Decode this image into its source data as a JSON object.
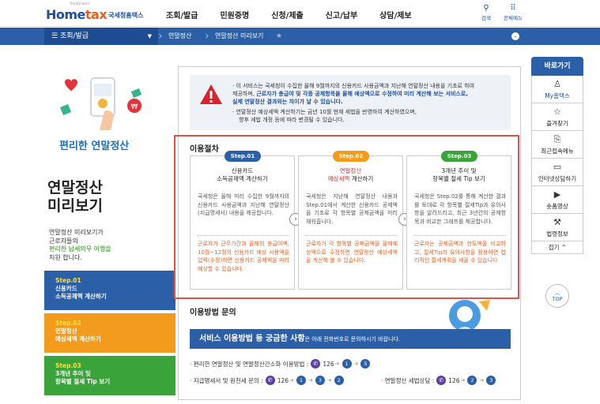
{
  "header": {
    "logo_small": "전자세무서비스",
    "logo_brand_a": "Home",
    "logo_brand_b": "tax",
    "logo_org": "국세청홈택스",
    "gnb": [
      "조회/발급",
      "민원증명",
      "신청/제출",
      "신고/납부",
      "상담/제보"
    ],
    "search_label": "검색",
    "allmenu_label": "전체메뉴"
  },
  "navbar": {
    "menu_label": "조회/발급",
    "crumb1": "연말정산",
    "crumb2": "연말정산 미리보기"
  },
  "left": {
    "illus_title": "편리한 연말정산",
    "title_line1": "연말정산",
    "title_line2": "미리보기",
    "desc1": "연말정산 미리보기가",
    "desc2": "근로자들의",
    "desc3": "편리한 납세의무 이행을",
    "desc4": "지원 합니다.",
    "steps": [
      {
        "num": "Step.01",
        "l1": "신용카드",
        "l2": "소득공제액 계산하기",
        "color": "#2b5fa8"
      },
      {
        "num": "Step.02",
        "l1": "연말정산",
        "l2": "예상세액 계산하기",
        "color": "#f29b1d"
      },
      {
        "num": "Step.03",
        "l1": "3개년 추이 및",
        "l2": "항목별 절세 Tip 보기",
        "color": "#3aa33a"
      }
    ]
  },
  "notice": {
    "l1": "· 이 서비스는 국세청이 수집한 올해 9월까지의 신용카드 사용금액과 지난해 연말정산 내용을 기초로 하여",
    "l2a": "제공하며, ",
    "l2b": "근로자가 총급여 및 각종 공제항목을 올해 예상액으로 수정하여 미리 계산해 보는 서비스로,",
    "l3": "실제 연말정산 결과와는 차이가 날 수 있습니다.",
    "l4": "· 연말정산 예상세액 계산하기는 금년 10월 현재 세법을 반영하여 계산하였으며,",
    "l5": "향후 세법 개정 등에 따라 변경될 수 있습니다."
  },
  "procedure": {
    "title": "이용절차",
    "cards": [
      {
        "badge": "Step.01",
        "badge_color": "#2b5fa8",
        "t1": "신용카드",
        "t2": "소득공제액 계산하기",
        "body": "국세청은 올해 미리 수집한 9월까지의 신용카드 사용금액과 지난해 연말정산(지급명세서) 내용을 제공합니다.",
        "foot": "근로자가 근무기간과 올해의 총급여액, 10월~12월의 신용카드 예상 사용액을 입력(수정)하면 신용카드 공제액을 미리 예상할 수 있습니다."
      },
      {
        "badge": "Step.02",
        "badge_color": "#f29b1d",
        "t1": "연말정산",
        "t2": "예상세액",
        "t2b": " 계산하기",
        "body": "국세청은 지난해 연말정산 내용과 Step.01에서 계산한 신용카드 공제액을 기초로 각 항목별 공제금액을 미리 채워줍니다.",
        "foot": "근로자가 각 항목별 공제금액을 올해예상액으로 수정하면 연말정산 예상세액을 계산해 볼 수 있습니다."
      },
      {
        "badge": "Step.03",
        "badge_color": "#3aa33a",
        "t1": "3개년 추이 및",
        "t2": "항목별 절세 Tip 보기",
        "body": "국세청은 Step.02를 통해 계산한 결과를 토대로 각 항목별 절세Tip과 유의사항을 알려드리고, 최근 3년간의 공제항목과 비교한 그래프를 제공합니다.",
        "foot": "근로자는 공제금액과 한도액을 비교하고, 절세Tip과 유의사항을 활용하면 합리적인 절세계획을 세울 수 있습니다"
      }
    ]
  },
  "inquiry": {
    "title": "이용방법 문의",
    "bar_bold": "서비스 이용방법 등 궁금한 사항",
    "bar_rest": "은 아래 전화번호로 문의하시기 바랍니다.",
    "c1_label": "· 편리한 연말정산 및 연말정산간소화 이용방법 :",
    "c1_phone": "126",
    "c1_nums": [
      "1",
      "5"
    ],
    "c2_label": "· 지급명세서 및 원천세 문의 :",
    "c2_phone": "126",
    "c2_nums": [
      "1",
      "3",
      "2"
    ],
    "c3_label": "· 연말정산 세법상담 :",
    "c3_phone": "126",
    "c3_nums": [
      "2",
      "3"
    ]
  },
  "quick": {
    "title": "바로가기",
    "items": [
      {
        "label": "My홈택스",
        "icon": "user-icon"
      },
      {
        "label": "즐겨찾기",
        "icon": "star-icon"
      },
      {
        "label": "최근접속메뉴",
        "icon": "recent-icon"
      },
      {
        "label": "인터넷상담하기",
        "icon": "monitor-icon"
      },
      {
        "label": "숏폼영상",
        "icon": "play-icon"
      },
      {
        "label": "법령정보",
        "icon": "gavel-icon"
      }
    ],
    "fold": "접기 ^",
    "top": "TOP"
  }
}
